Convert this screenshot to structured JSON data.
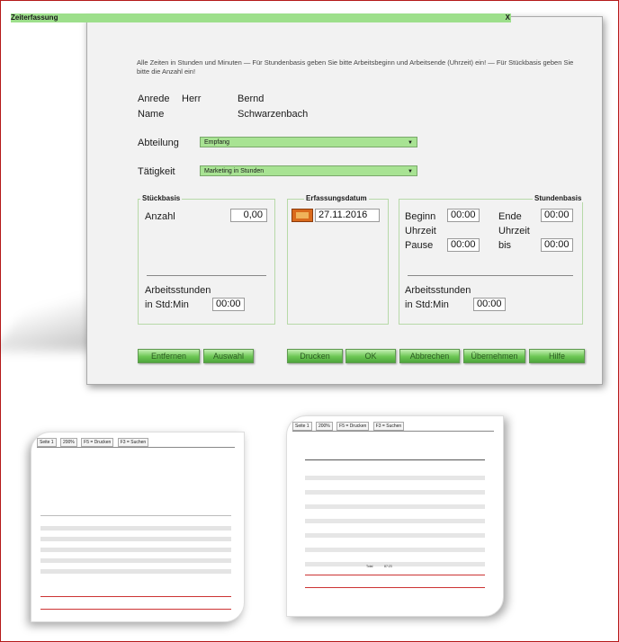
{
  "window": {
    "title": "Zeiterfassung",
    "close_glyph": "X",
    "info_text": "Alle Zeiten in Stunden und Minuten  — Für Stundenbasis geben Sie bitte Arbeitsbeginn und Arbeitsende (Uhrzeit) ein!  — Für Stückbasis geben Sie bitte die Anzahl ein!"
  },
  "person": {
    "anrede_label": "Anrede",
    "anrede_value": "Herr",
    "first_name": "Bernd",
    "name_label": "Name",
    "last_name": "Schwarzenbach"
  },
  "abteilung": {
    "label": "Abteilung",
    "value": "Empfang"
  },
  "taetigkeit": {
    "label": "Tätigkeit",
    "value": "Marketing in Stunden"
  },
  "stueckbasis": {
    "title": "Stückbasis",
    "anzahl_label": "Anzahl",
    "anzahl_value": "0,00",
    "arbeitsstunden_label": "Arbeitsstunden",
    "std_min_label": "in Std:Min",
    "std_min_value": "00:00"
  },
  "erfassung": {
    "title": "Erfassungsdatum",
    "date": "27.11.2016",
    "icon": "calendar-icon"
  },
  "stundenbasis": {
    "title": "Stundenbasis",
    "beginn_label": "Beginn",
    "beginn_value": "00:00",
    "ende_label": "Ende",
    "ende_value": "00:00",
    "uhrzeit_label_1": "Uhrzeit",
    "uhrzeit_label_2": "Uhrzeit",
    "pause_label": "Pause",
    "pause_value": "00:00",
    "bis_label": "bis",
    "bis_value": "00:00",
    "arbeitsstunden_label": "Arbeitsstunden",
    "std_min_label": "in Std:Min",
    "std_min_value": "00:00"
  },
  "buttons": {
    "entfernen": "Entfernen",
    "auswahl": "Auswahl",
    "drucken": "Drucken",
    "ok": "OK",
    "abbrechen": "Abbrechen",
    "uebernehmen": "Übernehmen",
    "hilfe": "Hilfe"
  },
  "thumb_left": {
    "page": "Seite 1",
    "zoom": "200%",
    "find": "F3 = Suchen",
    "find_next": "F5 = Drucken"
  },
  "thumb_right": {
    "page": "Seite 1",
    "zoom": "200%",
    "find": "F3 = Suchen",
    "find_next": "F5 = Drucken",
    "total_label": "Total",
    "total_value": "87:23"
  },
  "colors": {
    "accent_green": "#6bc653",
    "field_green": "#a8e393",
    "frame_red": "#b51a1a"
  }
}
